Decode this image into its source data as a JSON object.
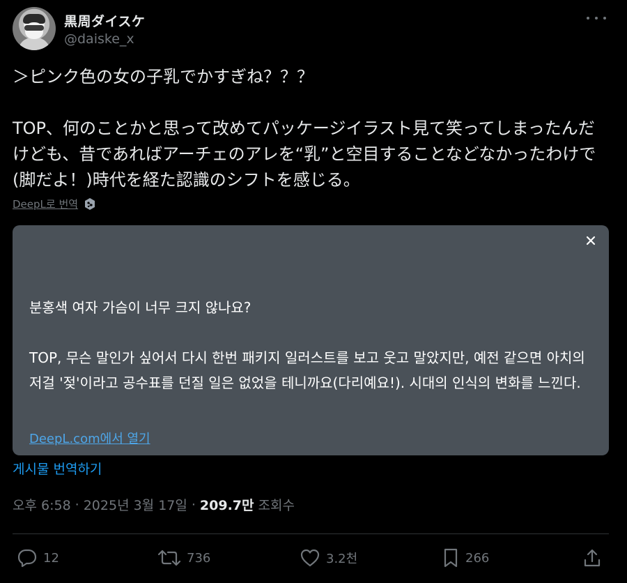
{
  "author": {
    "display_name": "黒周ダイスケ",
    "handle": "@daiske_x"
  },
  "tweet": {
    "text": "＞ピンク色の女の子乳でかすぎね？？？\n\nTOP、何のことかと思って改めてパッケージイラスト見て笑ってしまったんだけども、昔であればアーチェのアレを“乳”と空目することなどなかったわけで(脚だよ！)時代を経た認識のシフトを感じる。"
  },
  "deepl": {
    "link_label": "DeepL로 번역"
  },
  "translation": {
    "text": "분홍색 여자 가슴이 너무 크지 않나요?\n\nTOP, 무슨 말인가 싶어서 다시 한번 패키지 일러스트를 보고 웃고 말았지만, 예전 같으면 아치의 저걸 '젖'이라고 공수표를 던질 일은 없었을 테니까요(다리예요!). 시대의 인식의 변화를 느낀다.",
    "open_label": "DeepL.com에서 열기"
  },
  "translate_post_label": "게시물 번역하기",
  "meta": {
    "time": "오후 6:58",
    "date": "2025년 3월 17일",
    "views_count": "209.7만",
    "views_label": "조회수",
    "separator": "·"
  },
  "actions": {
    "reply_count": "12",
    "retweet_count": "736",
    "like_count": "3.2천",
    "bookmark_count": "266"
  },
  "colors": {
    "background": "#000000",
    "text": "#e7e9ea",
    "muted": "#71767b",
    "accent": "#1d9bf0",
    "card": "#4a5158"
  },
  "icons": {
    "more": "more-dots-icon",
    "deepl": "deepl-icon",
    "close": "close-icon",
    "reply": "reply-icon",
    "retweet": "retweet-icon",
    "like": "heart-icon",
    "bookmark": "bookmark-icon",
    "share": "share-icon"
  }
}
